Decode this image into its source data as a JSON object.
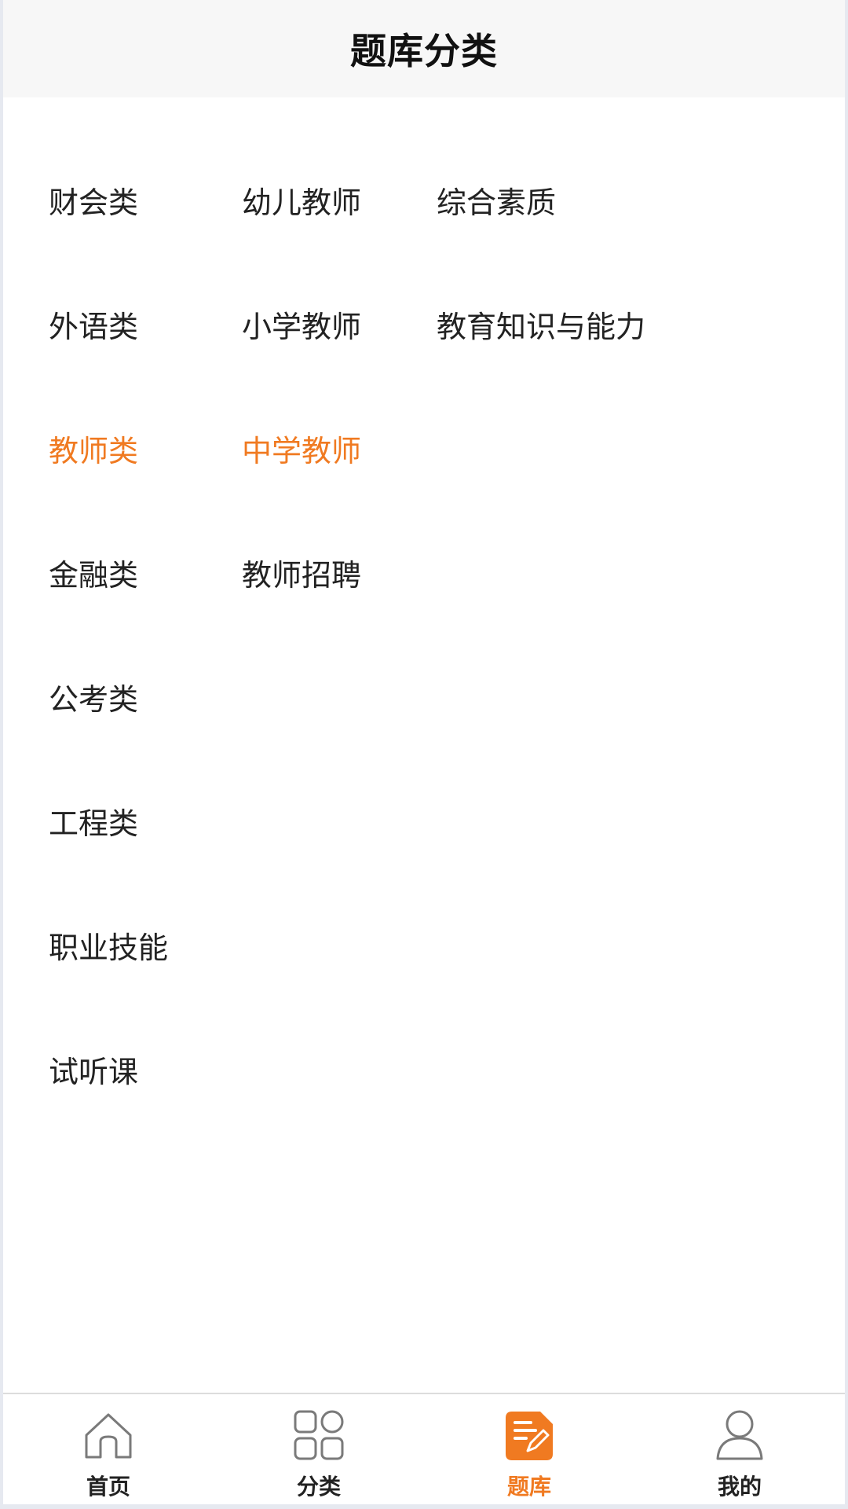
{
  "header": {
    "title": "题库分类"
  },
  "columns": {
    "col1": [
      "财会类",
      "外语类",
      "教师类",
      "金融类",
      "公考类",
      "工程类",
      "职业技能",
      "试听课"
    ],
    "col2": [
      "幼儿教师",
      "小学教师",
      "中学教师",
      "教师招聘"
    ],
    "col3": [
      "综合素质",
      "教育知识与能力"
    ]
  },
  "selected": {
    "col1": "教师类",
    "col2": "中学教师"
  },
  "accent_color": "#f07a21",
  "tabbar": {
    "items": [
      {
        "label": "首页",
        "icon": "home-icon"
      },
      {
        "label": "分类",
        "icon": "grid-icon"
      },
      {
        "label": "题库",
        "icon": "edit-note-icon",
        "active": true
      },
      {
        "label": "我的",
        "icon": "user-icon"
      }
    ]
  }
}
